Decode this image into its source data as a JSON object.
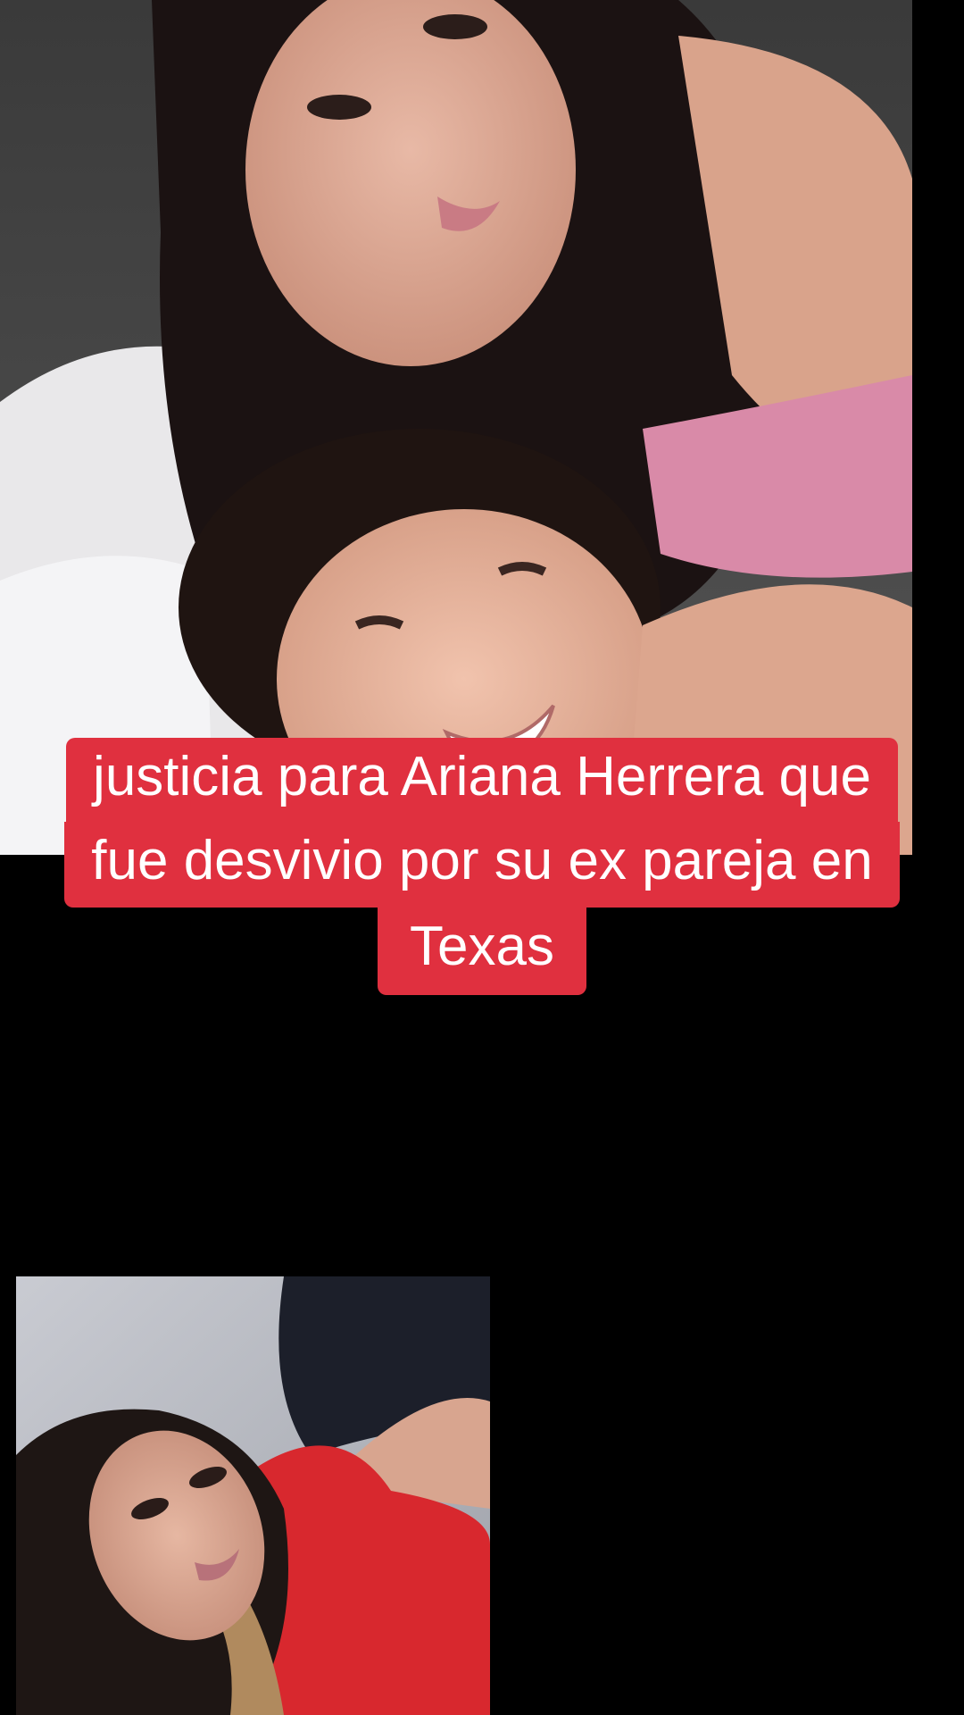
{
  "caption": {
    "line1": "justicia para Ariana Herrera que",
    "line2": "fue desvivio por su ex pareja en",
    "line3": "Texas"
  },
  "colors": {
    "background": "#000000",
    "caption_background": "#e0303f",
    "caption_text": "#ffffff"
  }
}
